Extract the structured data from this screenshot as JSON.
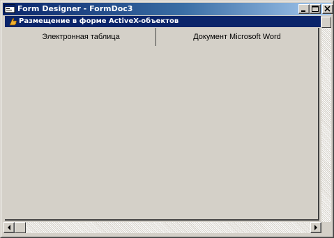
{
  "window": {
    "title": "Form Designer - FormDoc3"
  },
  "form": {
    "caption": "Размещение в форме ActiveX-объектов",
    "controls": [
      {
        "label": "Электронная таблица"
      },
      {
        "label": "Документ Microsoft Word"
      }
    ]
  },
  "icons": {
    "app": "form-designer-icon",
    "caption": "pointing-hand-icon",
    "minimize": "minimize-icon",
    "maximize": "maximize-icon",
    "close": "close-icon",
    "scroll_left": "arrow-left-icon",
    "scroll_right": "arrow-right-icon"
  },
  "colors": {
    "titlebar_start": "#0a246a",
    "titlebar_end": "#a6caf0",
    "face": "#d4d0c8"
  }
}
